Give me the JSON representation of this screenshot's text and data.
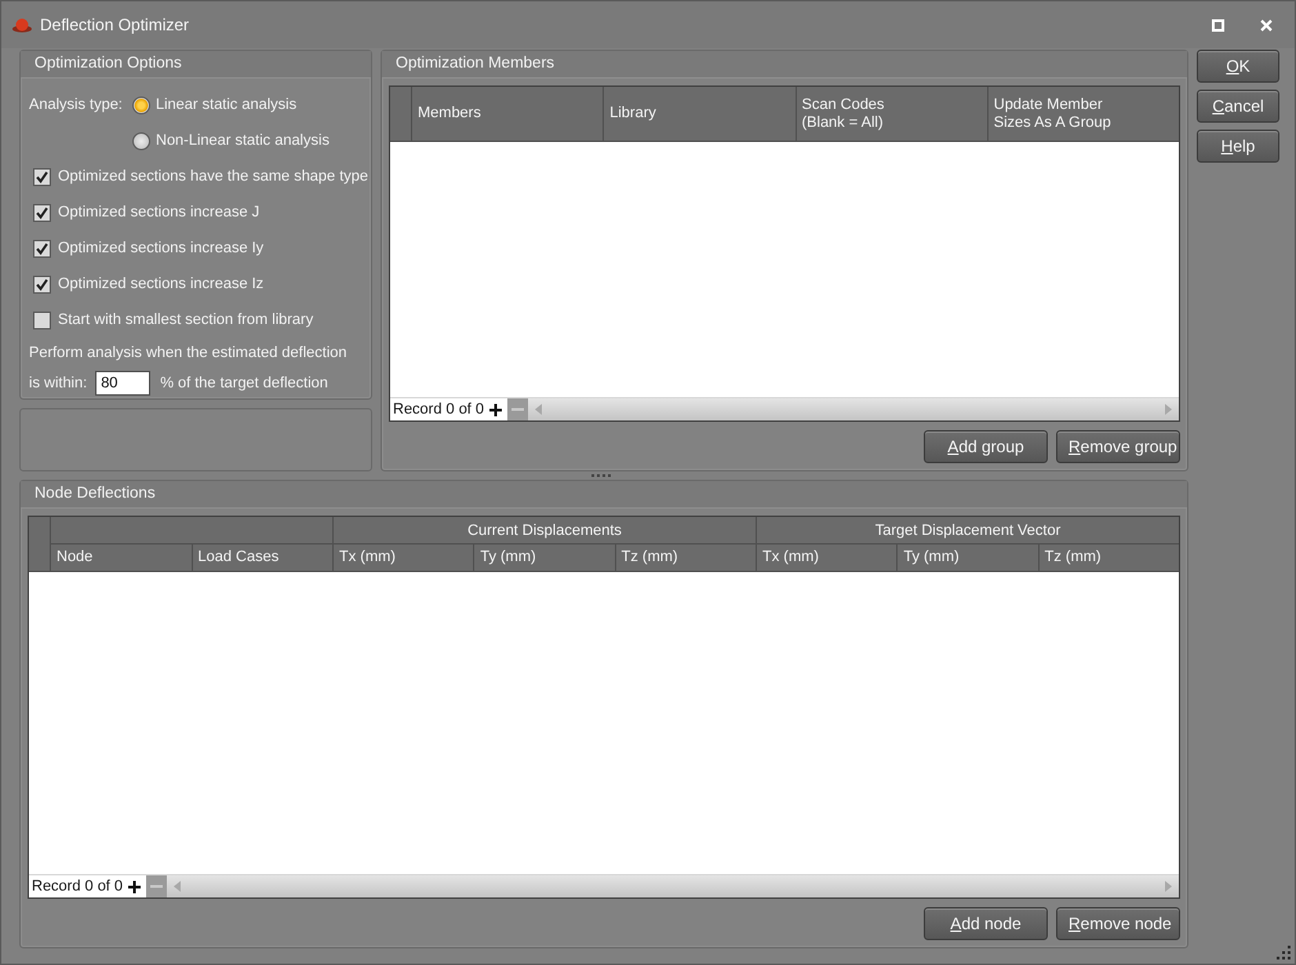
{
  "window": {
    "title": "Deflection Optimizer"
  },
  "options": {
    "title": "Optimization Options",
    "analysis_label": "Analysis type:",
    "analysis_types": [
      {
        "label": "Linear static analysis",
        "selected": true
      },
      {
        "label": "Non-Linear static analysis",
        "selected": false
      }
    ],
    "checks": [
      {
        "label": "Optimized sections have the same shape type",
        "checked": true
      },
      {
        "label": "Optimized sections increase J",
        "checked": true
      },
      {
        "label": "Optimized sections increase Iy",
        "checked": true
      },
      {
        "label": "Optimized sections increase Iz",
        "checked": true
      },
      {
        "label": "Start with smallest section from library",
        "checked": false
      }
    ],
    "threshold": {
      "text_before": "Perform analysis when the estimated deflection",
      "label": "is within:",
      "value": "80",
      "text_after": "% of the target deflection"
    }
  },
  "members": {
    "title": "Optimization Members",
    "columns": [
      "Members",
      "Library",
      "Scan Codes\n(Blank = All)",
      "Update Member\nSizes As A Group"
    ],
    "record": "Record 0 of 0",
    "buttons": [
      {
        "key": "A",
        "rest": "dd group"
      },
      {
        "key": "R",
        "rest": "emove group"
      }
    ]
  },
  "dialog_buttons": [
    {
      "key": "O",
      "rest": "K"
    },
    {
      "key": "C",
      "rest": "ancel"
    },
    {
      "key": "H",
      "rest": "elp"
    }
  ],
  "nodes": {
    "title": "Node Deflections",
    "column_groups": [
      {
        "columns": [
          "Node",
          "Load Cases"
        ]
      },
      {
        "label": "Current Displacements",
        "columns": [
          "Tx (mm)",
          "Ty (mm)",
          "Tz (mm)"
        ]
      },
      {
        "label": "Target Displacement Vector",
        "columns": [
          "Tx (mm)",
          "Ty (mm)",
          "Tz (mm)"
        ]
      }
    ],
    "record": "Record 0 of 0",
    "buttons": [
      {
        "key": "A",
        "rest": "dd node"
      },
      {
        "key": "R",
        "rest": "emove node"
      }
    ]
  }
}
